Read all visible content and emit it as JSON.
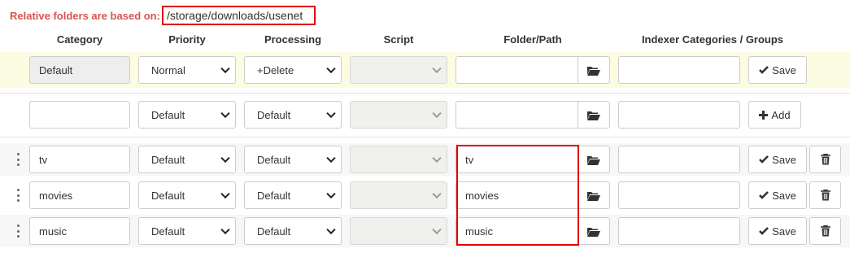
{
  "notice": {
    "label": "Relative folders are based on:",
    "path": "/storage/downloads/usenet"
  },
  "columns": {
    "category": "Category",
    "priority": "Priority",
    "processing": "Processing",
    "script": "Script",
    "folder": "Folder/Path",
    "indexer": "Indexer Categories / Groups"
  },
  "default_row": {
    "category": "Default",
    "priority": "Normal",
    "processing": "+Delete",
    "script": "",
    "folder": "",
    "indexer": "",
    "action_label": "Save"
  },
  "new_row": {
    "category": "",
    "priority": "Default",
    "processing": "Default",
    "script": "",
    "folder": "",
    "indexer": "",
    "action_label": "Add"
  },
  "rows": [
    {
      "category": "tv",
      "priority": "Default",
      "processing": "Default",
      "script": "",
      "folder": "tv",
      "indexer": "",
      "action_label": "Save"
    },
    {
      "category": "movies",
      "priority": "Default",
      "processing": "Default",
      "script": "",
      "folder": "movies",
      "indexer": "",
      "action_label": "Save"
    },
    {
      "category": "music",
      "priority": "Default",
      "processing": "Default",
      "script": "",
      "folder": "music",
      "indexer": "",
      "action_label": "Save"
    }
  ],
  "icons": {
    "folder": "folder-open-icon",
    "save": "check-icon",
    "add": "plus-icon",
    "delete": "trash-icon",
    "drag": "drag-handle-icon",
    "dropdown": "chevron-down-icon"
  },
  "colors": {
    "notice_label": "#d9534f",
    "highlight_border": "#e00000",
    "default_row_bg": "#fcfce3"
  }
}
